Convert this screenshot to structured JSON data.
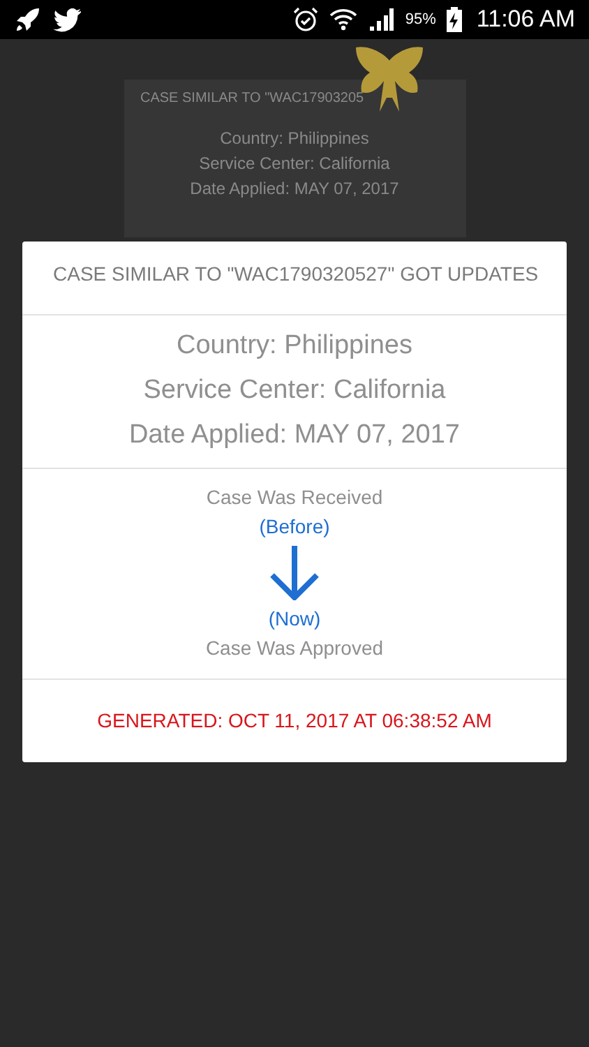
{
  "status_bar": {
    "battery": "95%",
    "time": "11:06 AM"
  },
  "background_card": {
    "title": "CASE SIMILAR TO \"WAC17903205",
    "lines": [
      "Country: Philippines",
      "Service Center: California",
      "Date Applied: MAY 07, 2017"
    ]
  },
  "dialog": {
    "title": "CASE SIMILAR TO \"WAC1790320527\" GOT UPDATES",
    "details": [
      "Country: Philippines",
      "Service Center: California",
      "Date Applied: MAY 07, 2017"
    ],
    "before_status": "Case Was Received",
    "before_label": "(Before)",
    "now_label": "(Now)",
    "now_status": "Case Was Approved",
    "generated": "GENERATED: OCT 11, 2017 AT 06:38:52 AM"
  }
}
